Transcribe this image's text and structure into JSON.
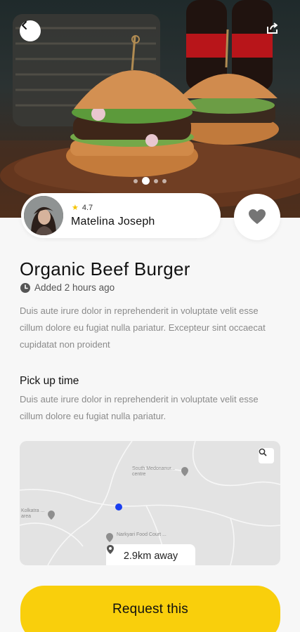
{
  "hero": {
    "image": "burger-photo",
    "carousel_dots": 4,
    "active_dot": 1
  },
  "author": {
    "rating": "4.7",
    "name": "Matelina Joseph"
  },
  "listing": {
    "title": "Organic Beef Burger",
    "added": "Added 2 hours ago",
    "description": "Duis aute irure dolor in reprehenderit in voluptate velit esse cillum dolore eu fugiat nulla pariatur. Excepteur sint occaecat cupidatat non proident"
  },
  "pickup": {
    "title": "Pick up time",
    "description": "Duis aute irure dolor in reprehenderit in voluptate velit esse cillum dolore eu fugiat nulla pariatur."
  },
  "map": {
    "label_1": "South Medonanur... centre",
    "label_2": "Kolkatra ... area",
    "label_3": "Narkyari Food Court ...",
    "distance": "2.9km away"
  },
  "actions": {
    "request_label": "Request this"
  },
  "colors": {
    "accent": "#f9cf0c",
    "location_dot": "#1a3ff0",
    "background": "#f7f7f7"
  },
  "icons": {
    "back": "chevron-left-icon",
    "share": "share-icon",
    "favorite": "heart-icon",
    "clock": "clock-icon",
    "star": "star-icon",
    "map_zoom": "zoom-icon",
    "pin": "location-pin-icon"
  }
}
